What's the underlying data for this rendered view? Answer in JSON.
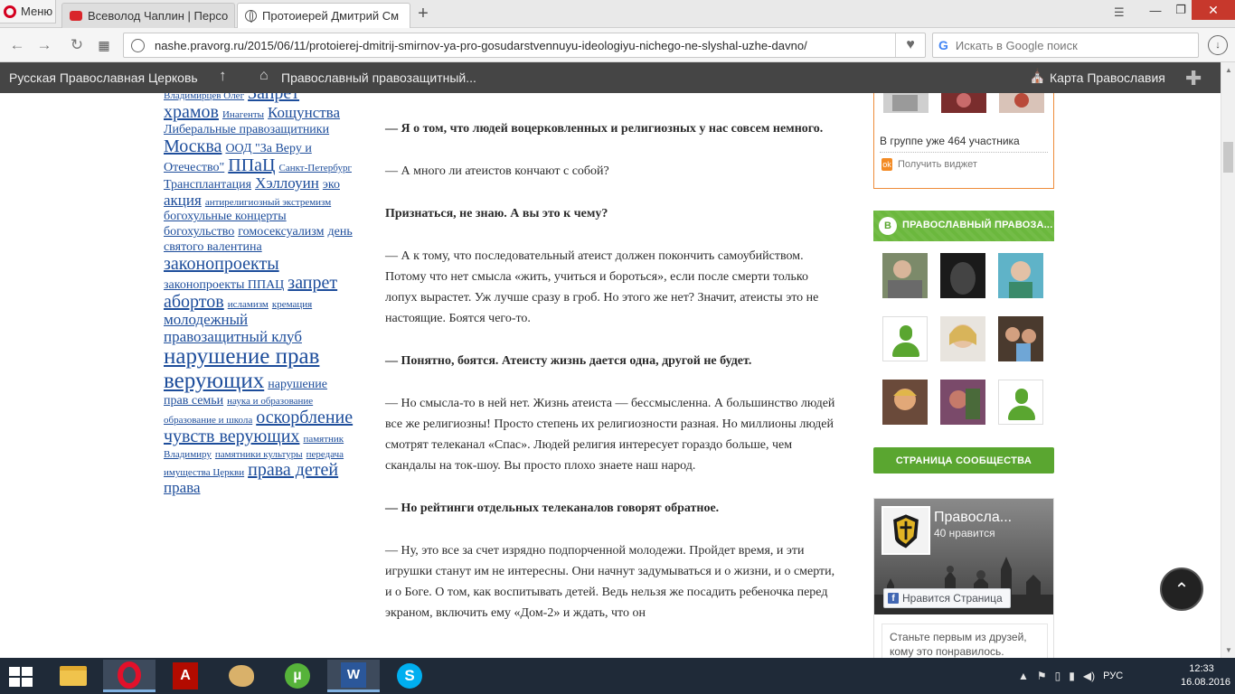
{
  "browser": {
    "menu_label": "Меню",
    "tabs": [
      {
        "label": "Всеволод Чаплин | Персо"
      },
      {
        "label": "Протоиерей Дмитрий См"
      }
    ],
    "new_tab": "+",
    "url": "nashe.pravorg.ru/2015/06/11/protoierej-dmitrij-smirnov-ya-pro-gosudarstvennuyu-ideologiyu-nichego-ne-slyshal-uzhe-davno/",
    "search_placeholder": "Искать в Google поиск"
  },
  "sitebar": {
    "left": "Русская Православная Церковь",
    "home": "Православный правозащитный...",
    "map": "Карта Православия"
  },
  "tagcloud": [
    {
      "text": "Владимирцев Олег",
      "size": 1
    },
    {
      "text": "Запрет храмов",
      "size": 4
    },
    {
      "text": "Инагенты",
      "size": 1
    },
    {
      "text": "Кощунства",
      "size": 3
    },
    {
      "text": "Либеральные правозащитники",
      "size": 2
    },
    {
      "text": "Москва",
      "size": 4
    },
    {
      "text": "ООД \"За Веру и Отечество\"",
      "size": 2
    },
    {
      "text": "ППаЦ",
      "size": 4
    },
    {
      "text": "Санкт-Петербург",
      "size": 1
    },
    {
      "text": "Трансплантация",
      "size": 2
    },
    {
      "text": "Хэллоуин",
      "size": 3
    },
    {
      "text": "эко",
      "size": 2
    },
    {
      "text": "акция",
      "size": 3
    },
    {
      "text": "антирелигиозный экстремизм",
      "size": 1
    },
    {
      "text": "богохульные концерты",
      "size": 2
    },
    {
      "text": "богохульство",
      "size": 2
    },
    {
      "text": "гомосексуализм",
      "size": 2
    },
    {
      "text": "день святого валентина",
      "size": 2
    },
    {
      "text": "законопроекты",
      "size": 4
    },
    {
      "text": "законопроекты ППАЦ",
      "size": 2
    },
    {
      "text": "запрет абортов",
      "size": 4
    },
    {
      "text": "исламизм",
      "size": 1
    },
    {
      "text": "кремация",
      "size": 1
    },
    {
      "text": "молодежный правозащитный клуб",
      "size": 3
    },
    {
      "text": "нарушение прав верующих",
      "size": 5
    },
    {
      "text": "нарушение прав семьи",
      "size": 2
    },
    {
      "text": "наука и образование",
      "size": 1
    },
    {
      "text": "образование и школа",
      "size": 1
    },
    {
      "text": "оскорбление чувств верующих",
      "size": 4
    },
    {
      "text": "памятник Владимиру",
      "size": 1
    },
    {
      "text": "памятники культуры",
      "size": 1
    },
    {
      "text": "передача имущества Церкви",
      "size": 1
    },
    {
      "text": "права детей",
      "size": 4
    },
    {
      "text": "права",
      "size": 3
    }
  ],
  "article": {
    "paragraphs": [
      {
        "bold": true,
        "text": "— Я о том, что людей воцерковленных и религиозных у нас совсем немного."
      },
      {
        "bold": false,
        "text": "— А много ли атеистов кончают с собой?"
      },
      {
        "bold": true,
        "text": "Признаться, не знаю. А вы это к чему?"
      },
      {
        "bold": false,
        "text": "— А к тому, что последовательный атеист должен покончить самоубийством. Потому что нет смысла «жить, учиться и бороться», если после смерти только лопух вырастет. Уж лучше сразу в гроб. Но этого же нет? Значит, атеисты это не настоящие. Боятся чего-то."
      },
      {
        "bold": true,
        "text": "— Понятно, боятся. Атеисту жизнь дается одна, другой не будет."
      },
      {
        "bold": false,
        "text": "— Но смысла-то в ней нет. Жизнь атеиста — бессмысленна. А большинство людей все же религиозны! Просто степень их религиозности разная. Но миллионы людей смотрят телеканал «Спас». Людей религия интересует гораздо больше, чем скандалы на ток-шоу. Вы просто плохо знаете наш народ."
      },
      {
        "bold": true,
        "text": "— Но рейтинги отдельных телеканалов говорят обратное."
      },
      {
        "bold": false,
        "text": "— Ну, это все за счет изрядно подпорченной молодежи. Пройдет время, и эти игрушки станут им не интересны. Они начнут задумываться и о жизни, и о смерти, и о Боге. О том, как воспитывать детей. Ведь нельзя же посадить ребеночка перед экраном, включить ему «Дом-2» и ждать, что он"
      }
    ]
  },
  "ok_widget": {
    "members_text": "В группе уже 464 участника",
    "get_widget": "Получить виджет"
  },
  "vk_widget": {
    "title": "ПРАВОСЛАВНЫЙ ПРАВОЗА...",
    "community_button": "СТРАНИЦА СООБЩЕСТВА"
  },
  "fb_widget": {
    "name": "Правосла...",
    "likes": "40 нравится",
    "like_button": "Нравится Страница",
    "friends_text": "Станьте первым из друзей, кому это понравилось."
  },
  "taskbar": {
    "lang": "РУС",
    "time": "12:33",
    "date": "16.08.2016"
  }
}
